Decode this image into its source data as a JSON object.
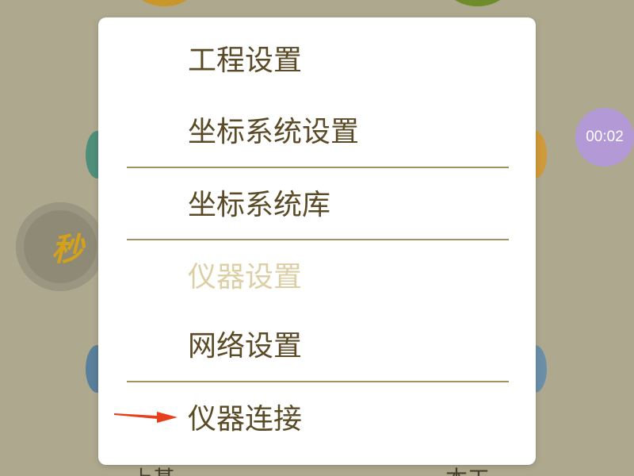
{
  "background": {
    "color": "#aea88e",
    "timer_text": "00:02",
    "seconds_glyph": "秒",
    "bottom_left_text": "上基",
    "bottom_right_text": "本工"
  },
  "menu": {
    "items": [
      {
        "label": "工程设置",
        "enabled": true
      },
      {
        "label": "坐标系统设置",
        "enabled": true
      },
      {
        "label": "坐标系统库",
        "enabled": true
      },
      {
        "label": "仪器设置",
        "enabled": false
      },
      {
        "label": "网络设置",
        "enabled": true
      },
      {
        "label": "仪器连接",
        "enabled": true
      }
    ],
    "text_color": "#5b4a26",
    "disabled_color": "#dccfa6",
    "divider_color": "#a39260"
  },
  "annotation": {
    "arrow_color": "#e8401c",
    "arrow_icon": "red-pointer-arrow-icon"
  }
}
